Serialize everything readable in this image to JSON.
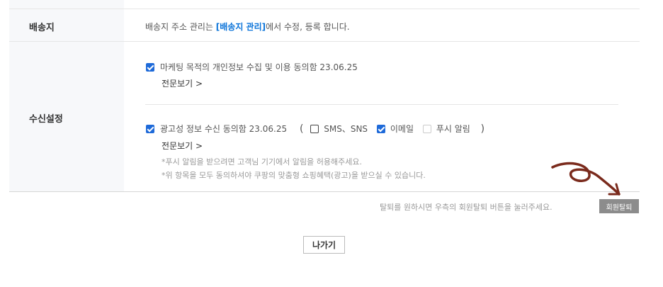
{
  "shipping": {
    "label": "배송지",
    "text_before": "배송지 주소 관리는 ",
    "link": "[배송지 관리]",
    "text_after": "에서 수정, 등록 합니다."
  },
  "receive": {
    "label": "수신설정",
    "marketing": {
      "checked": true,
      "text": "마케팅 목적의 개인정보 수집 및 이용 동의함 23.06.25",
      "more": "전문보기 >"
    },
    "ads": {
      "checked": true,
      "text": "광고성 정보 수신 동의함 23.06.25",
      "open_paren": "(",
      "options": [
        {
          "label": "SMS、SNS",
          "checked": false
        },
        {
          "label": "이메일",
          "checked": true
        },
        {
          "label": "푸시 알림",
          "checked": false,
          "disabled": true
        }
      ],
      "close_paren": ")",
      "more": "전문보기 >",
      "note1": "*푸시 알림을 받으려면 고객님 기기에서 알림을 허용해주세요.",
      "note2": "*위 항목을 모두 동의하셔야 쿠팡의 맞춤형 쇼핑혜택(광고)을 받으실 수 있습니다."
    }
  },
  "withdraw": {
    "text": "탈퇴를 원하시면 우측의 회원탈퇴 버튼을 눌러주세요.",
    "button": "회원탈퇴"
  },
  "exit_button": "나가기",
  "colors": {
    "accent": "#1e6ad9",
    "link": "#0a73d9",
    "arrow": "#7a2a1c"
  }
}
